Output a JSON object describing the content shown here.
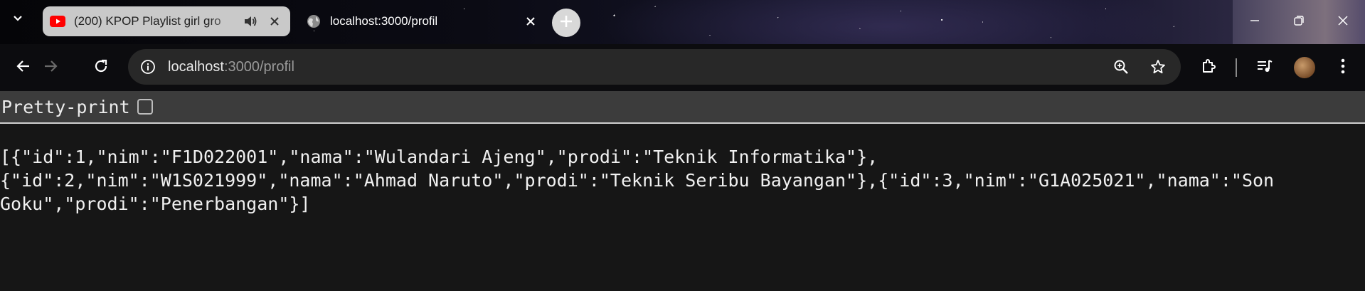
{
  "tabs": [
    {
      "title": "(200) KPOP Playlist girl gro",
      "favicon": "youtube-icon",
      "audio": true,
      "state": "inactive"
    },
    {
      "title": "localhost:3000/profil",
      "favicon": "globe-icon",
      "state": "active"
    }
  ],
  "address_bar": {
    "host": "localhost",
    "rest": ":3000/profil"
  },
  "page": {
    "pretty_print_label": "Pretty-print",
    "pretty_print_checked": false,
    "json_lines": [
      "[{\"id\":1,\"nim\":\"F1D022001\",\"nama\":\"Wulandari Ajeng\",\"prodi\":\"Teknik Informatika\"},",
      "{\"id\":2,\"nim\":\"W1S021999\",\"nama\":\"Ahmad Naruto\",\"prodi\":\"Teknik Seribu Bayangan\"},{\"id\":3,\"nim\":\"G1A025021\",\"nama\":\"Son",
      "Goku\",\"prodi\":\"Penerbangan\"}]"
    ]
  },
  "colors": {
    "youtube_red": "#ff0000",
    "page_bg": "#161616",
    "toolbar_bar": "#3c3c3c"
  }
}
